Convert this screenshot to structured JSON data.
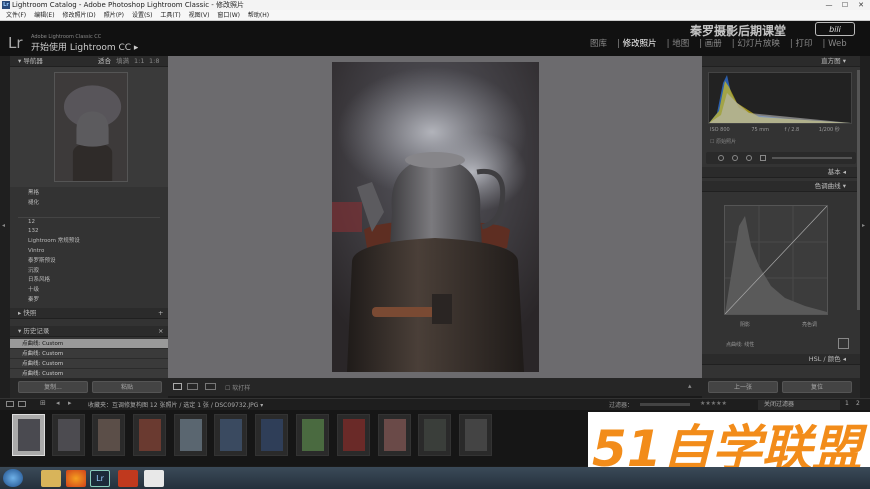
{
  "window": {
    "title": "Lightroom Catalog - Adobe Photoshop Lightroom Classic - 修改照片"
  },
  "menu": [
    "文件(F)",
    "编辑(E)",
    "修改照片(D)",
    "照片(P)",
    "设置(S)",
    "工具(T)",
    "视图(V)",
    "窗口(W)",
    "帮助(H)"
  ],
  "identity": {
    "logo": "Lr",
    "subtitle": "Adobe Lightroom Classic CC",
    "title": "开始使用 Lightroom CC",
    "arrow": "▸"
  },
  "modules": [
    "图库",
    "修改照片",
    "地图",
    "画册",
    "幻灯片放映",
    "打印",
    "Web"
  ],
  "active_module": "修改照片",
  "overlay_watermark": "秦罗摄影后期课堂",
  "navigator": {
    "title": "导航器",
    "zoom": [
      "适合",
      "填满",
      "1:1",
      "1:8"
    ]
  },
  "presets": [
    "黑格",
    "褪化",
    "12",
    "132",
    "Lightroom 常规预设",
    "Vintro",
    "泰罗斯预设",
    "沉寂",
    "日系风格",
    "十级",
    "秦罗"
  ],
  "snapshots": {
    "title": "快照",
    "icon": "+"
  },
  "history": {
    "title": "历史记录",
    "icon": "×",
    "items": [
      "点曲线: Custom",
      "点曲线: Custom",
      "点曲线: Custom",
      "点曲线: Custom"
    ]
  },
  "left_buttons": {
    "copy": "复制...",
    "paste": "粘贴"
  },
  "right_panel": {
    "histogram_title": "直方图",
    "histogram_info": [
      "ISO 800",
      "75 mm",
      "f / 2.8",
      "1/200 秒"
    ],
    "original_label": "原始照片",
    "basic_title": "基本",
    "tone_curve_title": "色调曲线",
    "curve_labels": [
      "阴影",
      "亮色调"
    ],
    "channel_label": "点曲线: 线性",
    "hsl_title": "HSL / 颜色",
    "prev_button": "上一张",
    "reset_button": "复位"
  },
  "toolbar": {
    "softproof": "软打样"
  },
  "filmstrip": {
    "path": "收藏夹：互调修复构图   12 张照片 / 选定 1 张 / DSC09732.JPG ▾",
    "filter_label": "过滤器：",
    "filter_value": "关闭过滤器",
    "page_numbers": [
      "1",
      "2"
    ]
  },
  "taskbar_icons": [
    "windows-start",
    "explorer",
    "firefox",
    "lightroom",
    "powerpoint",
    "other-app"
  ],
  "brand_watermark": "51自学联盟"
}
